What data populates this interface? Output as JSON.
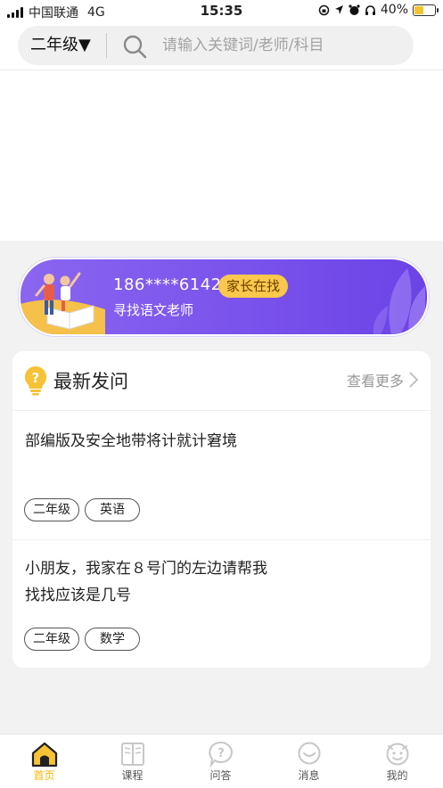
{
  "status_bar": {
    "carrier": "中国联通",
    "network": "4G",
    "time": "15:35",
    "battery": "40%",
    "battery_level": 0.4
  },
  "search": {
    "grade_select": "二年级▼",
    "placeholder": "请输入关键词/老师/科目"
  },
  "banner": {
    "phone": "186****6142",
    "badge": "家长在找",
    "subtitle": "寻找语文老师"
  },
  "questions_section": {
    "title": "最新发问",
    "more": "查看更多",
    "items": [
      {
        "text": "部编版及安全地带将计就计窘境",
        "tags": [
          "二年级",
          "英语"
        ]
      },
      {
        "text": "小朋友，我家在８号门的左边请帮我找找应该是几号",
        "tags": [
          "二年级",
          "数学"
        ]
      }
    ]
  },
  "tab_bar": {
    "items": [
      {
        "label": "首页",
        "icon": "home-icon",
        "active": true
      },
      {
        "label": "课程",
        "icon": "book-icon"
      },
      {
        "label": "问答",
        "icon": "qa-icon"
      },
      {
        "label": "消息",
        "icon": "message-icon"
      },
      {
        "label": "我的",
        "icon": "profile-icon"
      }
    ]
  },
  "colors": {
    "accent": "#f5b400",
    "banner": "#7a52ec",
    "badge": "#f9c84c",
    "background": "#f2f2f2"
  }
}
